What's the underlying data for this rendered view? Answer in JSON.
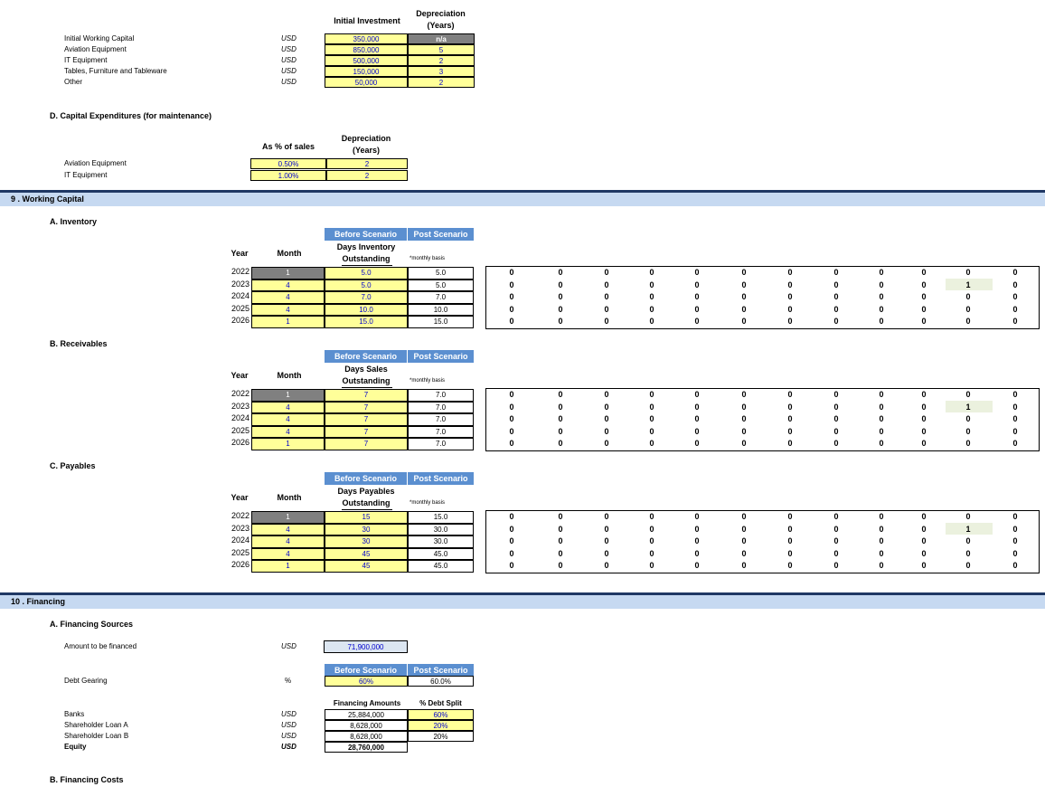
{
  "capex": {
    "col_initial": "Initial Investment",
    "col_dep": "Depreciation (Years)",
    "rows": [
      {
        "label": "Initial Working Capital",
        "currency": "USD",
        "investment": "350,000",
        "dep": "n/a"
      },
      {
        "label": "Aviation Equipment",
        "currency": "USD",
        "investment": "850,000",
        "dep": "5"
      },
      {
        "label": "IT Equipment",
        "currency": "USD",
        "investment": "500,000",
        "dep": "2"
      },
      {
        "label": "Tables, Furniture and Tableware",
        "currency": "USD",
        "investment": "150,000",
        "dep": "3"
      },
      {
        "label": "Other",
        "currency": "USD",
        "investment": "50,000",
        "dep": "2"
      }
    ]
  },
  "maint": {
    "title": "D.  Capital Expenditures (for maintenance)",
    "col_pct": "As % of sales",
    "col_dep": "Depreciation (Years)",
    "rows": [
      {
        "label": "Aviation Equipment",
        "pct": "0.50%",
        "dep": "2"
      },
      {
        "label": "IT Equipment",
        "pct": "1.00%",
        "dep": "2"
      }
    ]
  },
  "wc": {
    "section": "9 . Working Capital",
    "before": "Before Scenario",
    "post": "Post Scenario",
    "year_label": "Year",
    "month_label": "Month",
    "note": "*monthly basis",
    "years": [
      "2022",
      "2023",
      "2024",
      "2025",
      "2026"
    ],
    "months": [
      "1",
      "4",
      "4",
      "4",
      "1"
    ],
    "grid_row": [
      "0",
      "0",
      "0",
      "0",
      "0",
      "0",
      "0",
      "0",
      "0",
      "0",
      "0",
      "0"
    ],
    "grid_row_hl": [
      "0",
      "0",
      "0",
      "0",
      "0",
      "0",
      "0",
      "0",
      "0",
      "0",
      "1",
      "0"
    ],
    "blocks": [
      {
        "title": "A.  Inventory",
        "metric": "Days Inventory Outstanding",
        "before": [
          "5.0",
          "5.0",
          "7.0",
          "10.0",
          "15.0"
        ],
        "post": [
          "5.0",
          "5.0",
          "7.0",
          "10.0",
          "15.0"
        ]
      },
      {
        "title": "B.  Receivables",
        "metric": "Days Sales Outstanding",
        "before": [
          "7",
          "7",
          "7",
          "7",
          "7"
        ],
        "post": [
          "7.0",
          "7.0",
          "7.0",
          "7.0",
          "7.0"
        ]
      },
      {
        "title": "C.  Payables",
        "metric": "Days Payables Outstanding",
        "before": [
          "15",
          "30",
          "30",
          "45",
          "45"
        ],
        "post": [
          "15.0",
          "30.0",
          "30.0",
          "45.0",
          "45.0"
        ]
      }
    ]
  },
  "fin": {
    "section": "10 . Financing",
    "sources_title": "A.  Financing Sources",
    "amount_label": "Amount to be financed",
    "amount_cur": "USD",
    "amount": "71,900,000",
    "before": "Before Scenario",
    "post": "Post Scenario",
    "gearing_label": "Debt Gearing",
    "gearing_unit": "%",
    "gearing_before": "60%",
    "gearing_post": "60.0%",
    "col_amounts": "Financing Amounts",
    "col_split": "% Debt Split",
    "rows": [
      {
        "label": "Banks",
        "cur": "USD",
        "amount": "25,884,000",
        "split": "60%",
        "bold": false
      },
      {
        "label": "Shareholder Loan A",
        "cur": "USD",
        "amount": "8,628,000",
        "split": "20%",
        "bold": false
      },
      {
        "label": "Shareholder Loan B",
        "cur": "USD",
        "amount": "8,628,000",
        "split": "20%",
        "bold": false
      },
      {
        "label": "Equity",
        "cur": "USD",
        "amount": "28,760,000",
        "split": "",
        "bold": true
      }
    ],
    "costs_title": "B.  Financing Costs"
  }
}
